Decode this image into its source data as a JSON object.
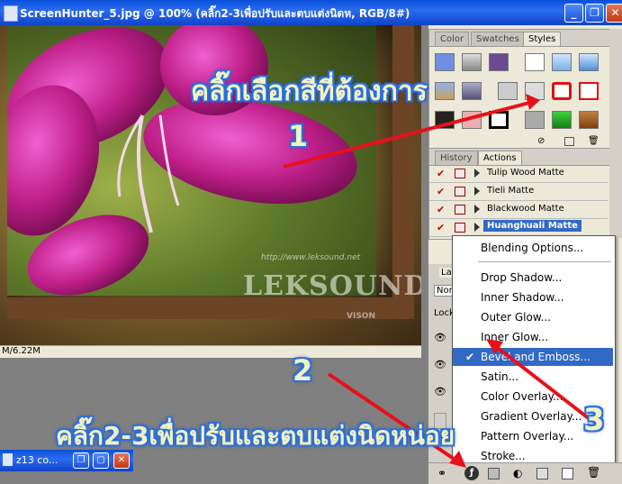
{
  "document": {
    "title": "ScreenHunter_5.jpg @ 100% (คลิ๊ก2-3เพื่อปรับและตบแต่งนิดห, RGB/8#)",
    "status": "M/6.22M",
    "watermark": "LEKSOUND",
    "watermark_sub": "VISON",
    "watermark_url": "http://www.leksound.net"
  },
  "window_buttons": {
    "minimize": "_",
    "restore": "❐",
    "close": "✕"
  },
  "minimized_window": {
    "title": "z13 co..."
  },
  "styles_panel": {
    "tabs": [
      "Color",
      "Swatches",
      "Styles"
    ],
    "active_tab": "Styles"
  },
  "history_panel": {
    "tabs": [
      "History",
      "Actions"
    ],
    "active_tab": "Actions",
    "actions": [
      {
        "label": "Tulip Wood  Matte",
        "selected": false
      },
      {
        "label": "Tieli Matte",
        "selected": false
      },
      {
        "label": "Blackwood  Matte",
        "selected": false
      },
      {
        "label": "Huanghuali Matte",
        "selected": true
      }
    ]
  },
  "layers_panel": {
    "tab": "Laye",
    "blend": "Norm",
    "lock": "Lock:"
  },
  "context_menu": {
    "items": [
      {
        "label": "Blending Options...",
        "checked": false,
        "highlighted": false
      },
      {
        "label": "Drop Shadow...",
        "checked": false,
        "highlighted": false
      },
      {
        "label": "Inner Shadow...",
        "checked": false,
        "highlighted": false
      },
      {
        "label": "Outer Glow...",
        "checked": false,
        "highlighted": false
      },
      {
        "label": "Inner Glow...",
        "checked": false,
        "highlighted": false
      },
      {
        "label": "Bevel and Emboss...",
        "checked": true,
        "highlighted": true
      },
      {
        "label": "Satin...",
        "checked": false,
        "highlighted": false
      },
      {
        "label": "Color Overlay...",
        "checked": false,
        "highlighted": false
      },
      {
        "label": "Gradient Overlay...",
        "checked": false,
        "highlighted": false
      },
      {
        "label": "Pattern Overlay...",
        "checked": false,
        "highlighted": false
      },
      {
        "label": "Stroke...",
        "checked": false,
        "highlighted": false
      }
    ]
  },
  "annotations": {
    "top_text": "คลิ๊กเลือกสีที่ต้องการ",
    "bottom_text": "คลิ๊ก2-3เพื่อปรับและตบแต่งนิดหน่อย",
    "num1": "1",
    "num2": "2",
    "num3": "3"
  },
  "colors": {
    "title_bar": "#1043c8",
    "highlight": "#316ac5",
    "annotation_arrow": "#e8101a",
    "annotation_text_fill": "#f3f3c0",
    "annotation_text_outline": "#2a6fe0"
  }
}
